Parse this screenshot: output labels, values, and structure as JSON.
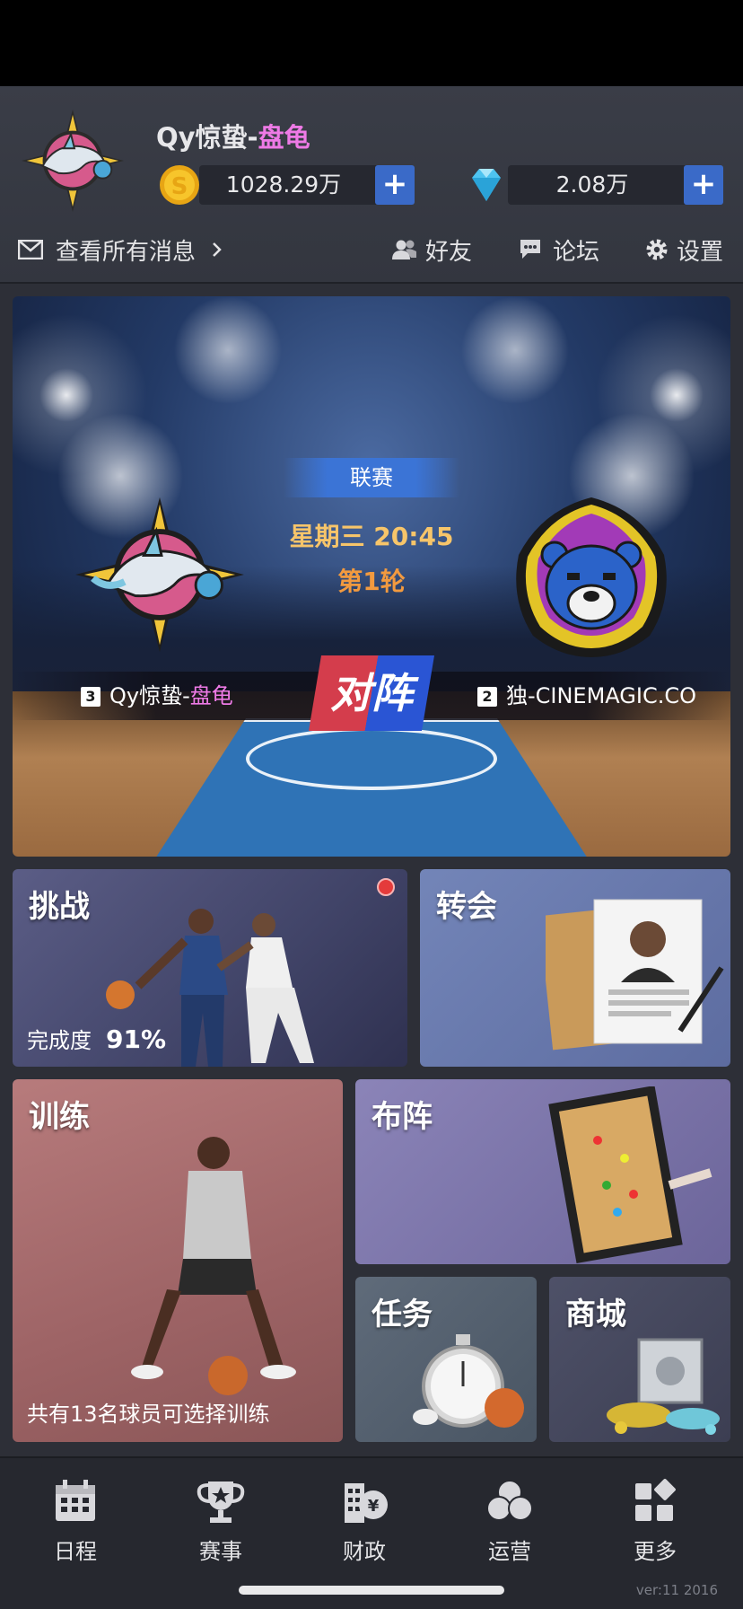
{
  "header": {
    "team_name_main": "Qy惊蛰-",
    "team_name_accent": "盘龟",
    "coins": "1028.29万",
    "diamonds": "2.08万",
    "plus_label": "+",
    "messages_label": "查看所有消息",
    "friends_label": "好友",
    "forum_label": "论坛",
    "settings_label": "设置",
    "icons": [
      "envelope-icon",
      "chevron-right-icon",
      "friends-icon",
      "forum-icon",
      "gear-icon",
      "coin-icon",
      "diamond-icon"
    ]
  },
  "match": {
    "league_label": "联赛",
    "time": "星期三 20:45",
    "round": "第1轮",
    "vs_label": "对阵",
    "home": {
      "rank": "3",
      "name_main": "Qy惊蛰-",
      "name_accent": "盘龟"
    },
    "away": {
      "rank": "2",
      "name": "独-CINEMAGIC.CO"
    }
  },
  "tiles": {
    "challenge": {
      "title": "挑战",
      "progress_label": "完成度",
      "progress_value": "91%",
      "has_notification": true
    },
    "transfer": {
      "title": "转会"
    },
    "training": {
      "title": "训练",
      "note": "共有13名球员可选择训练"
    },
    "formation": {
      "title": "布阵"
    },
    "tasks": {
      "title": "任务"
    },
    "shop": {
      "title": "商城"
    }
  },
  "nav": [
    {
      "label": "日程",
      "icon": "calendar-icon"
    },
    {
      "label": "赛事",
      "icon": "trophy-icon"
    },
    {
      "label": "财政",
      "icon": "finance-icon"
    },
    {
      "label": "运营",
      "icon": "operations-icon"
    },
    {
      "label": "更多",
      "icon": "more-icon"
    }
  ],
  "version": "ver:11  2016",
  "colors": {
    "accent_pink": "#ee7ae6",
    "plus_blue": "#3a6ac8",
    "time_gold": "#f7c56a",
    "round_orange": "#f29a3f",
    "notify_red": "#e43b3b"
  }
}
